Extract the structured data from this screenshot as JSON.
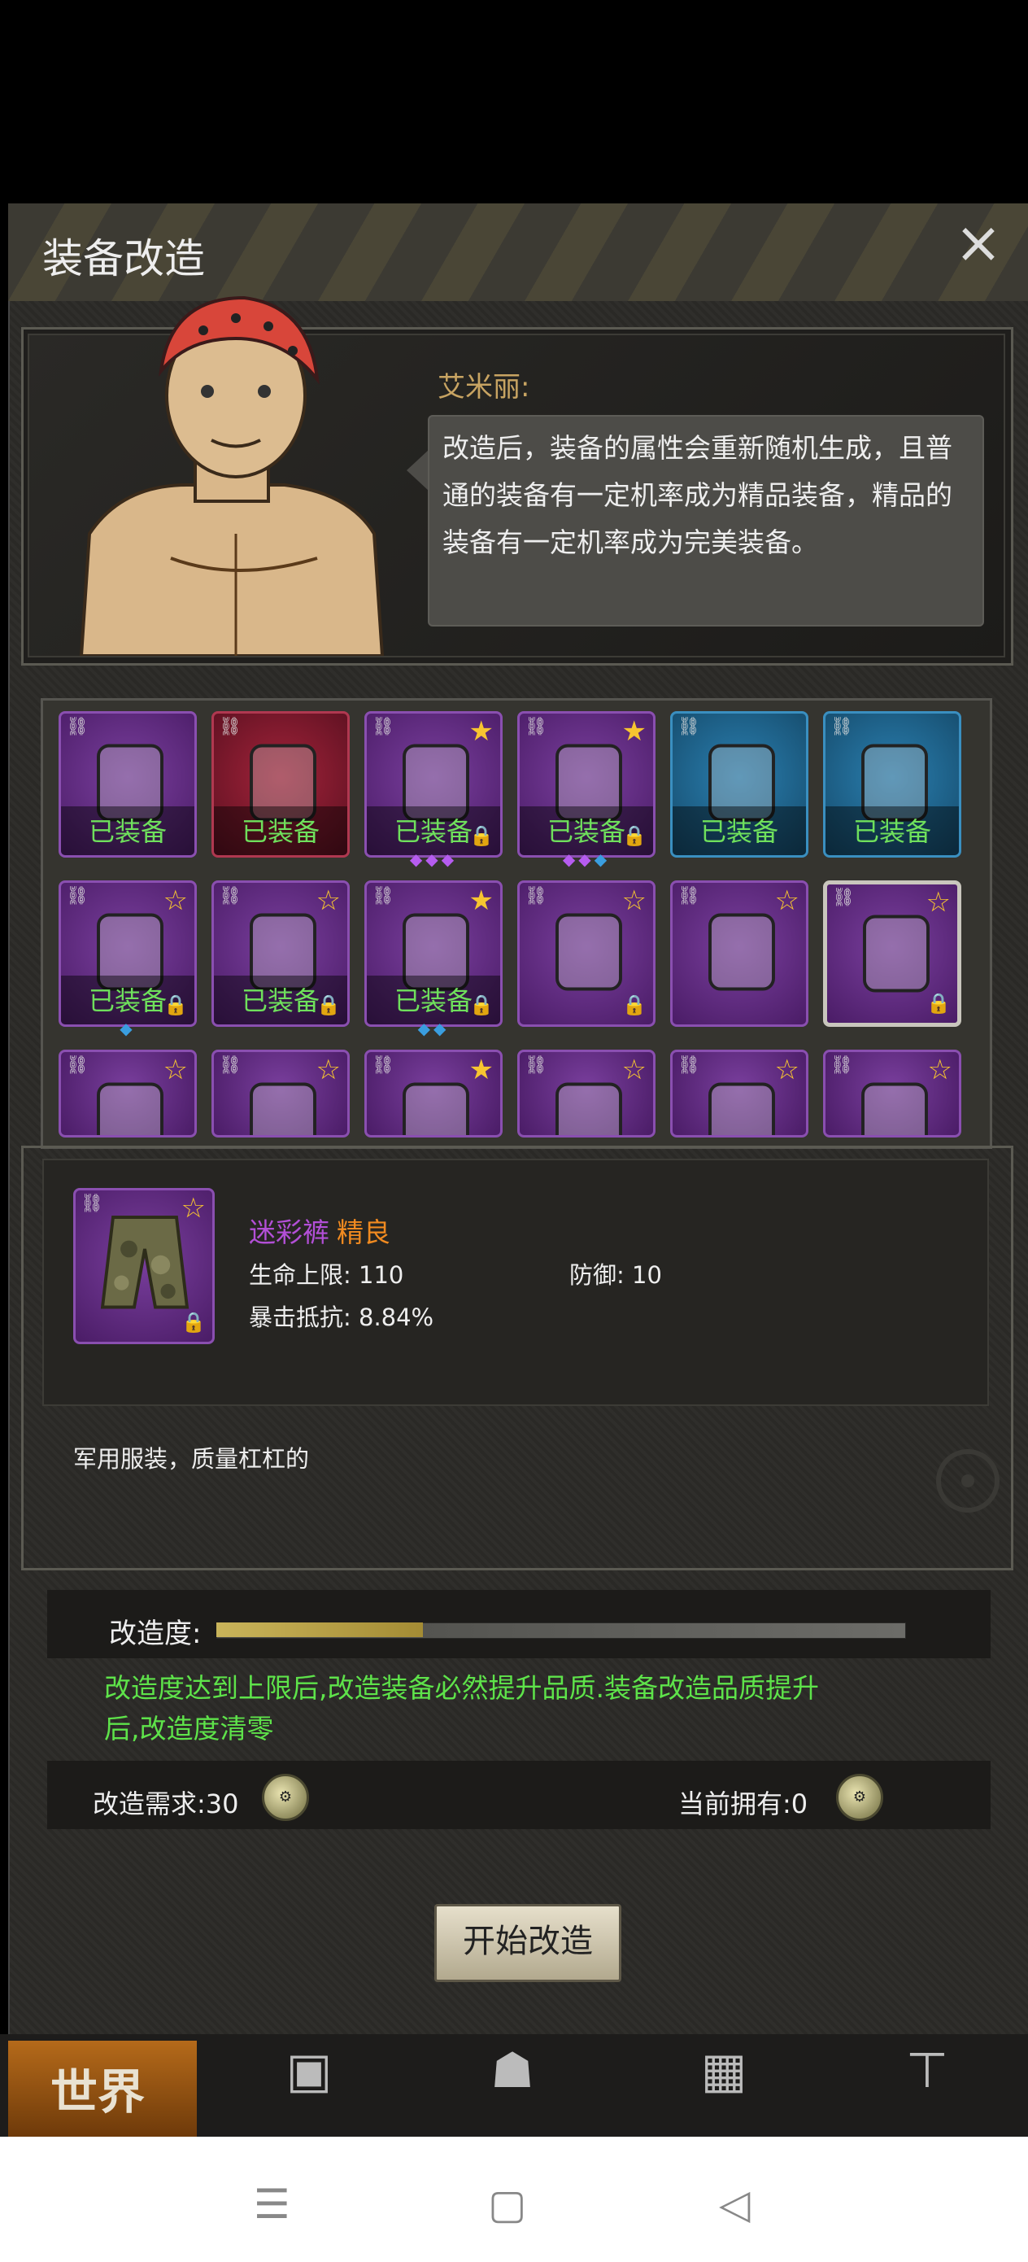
{
  "window": {
    "title": "装备改造",
    "close_icon": "close-icon"
  },
  "npc": {
    "name": "艾米丽:",
    "speech": "改造后，装备的属性会重新随机生成，且普通的装备有一定机率成为精品装备，精品的装备有一定机率成为完美装备。"
  },
  "inventory": {
    "equipped_label": "已装备",
    "items": [
      {
        "name": "parka-coat",
        "rarity": "purple",
        "equipped": true,
        "star": "none",
        "lock": false,
        "gems": []
      },
      {
        "name": "football-helmet",
        "rarity": "red",
        "equipped": true,
        "star": "none",
        "lock": false,
        "gems": []
      },
      {
        "name": "police-helmet",
        "rarity": "purple",
        "equipped": true,
        "star": "filled",
        "lock": true,
        "gems": [
          "purple",
          "purple",
          "purple"
        ]
      },
      {
        "name": "camo-rifle",
        "rarity": "purple",
        "equipped": true,
        "star": "filled",
        "lock": true,
        "gems": [
          "purple",
          "purple",
          "blue"
        ]
      },
      {
        "name": "riot-shield-1",
        "rarity": "blue",
        "equipped": true,
        "star": "none",
        "lock": false,
        "gems": []
      },
      {
        "name": "riot-shield-2",
        "rarity": "blue",
        "equipped": true,
        "star": "none",
        "lock": false,
        "gems": []
      },
      {
        "name": "katana",
        "rarity": "purple",
        "equipped": true,
        "star": "outline",
        "lock": true,
        "gems": [
          "blue"
        ]
      },
      {
        "name": "ice-sword",
        "rarity": "purple",
        "equipped": true,
        "star": "outline",
        "lock": true,
        "gems": []
      },
      {
        "name": "machete",
        "rarity": "purple",
        "equipped": true,
        "star": "filled",
        "lock": true,
        "gems": [
          "blue",
          "blue"
        ]
      },
      {
        "name": "tactical-vest",
        "rarity": "purple",
        "equipped": false,
        "star": "outline",
        "lock": true,
        "gems": []
      },
      {
        "name": "camo-boots",
        "rarity": "purple",
        "equipped": false,
        "star": "outline",
        "lock": false,
        "gems": []
      },
      {
        "name": "camo-pants",
        "rarity": "purple",
        "equipped": false,
        "star": "outline",
        "lock": true,
        "gems": [],
        "selected": true
      },
      {
        "name": "camo-vest",
        "rarity": "purple",
        "equipped": false,
        "star": "outline",
        "lock": false,
        "gems": []
      },
      {
        "name": "camo-jacket",
        "rarity": "purple",
        "equipped": false,
        "star": "outline",
        "lock": false,
        "gems": []
      },
      {
        "name": "camo-helmet",
        "rarity": "purple",
        "equipped": false,
        "star": "filled",
        "lock": false,
        "gems": []
      },
      {
        "name": "crossbow",
        "rarity": "purple",
        "equipped": false,
        "star": "outline",
        "lock": false,
        "gems": []
      },
      {
        "name": "sniper-rifle",
        "rarity": "purple",
        "equipped": false,
        "star": "outline",
        "lock": false,
        "gems": []
      },
      {
        "name": "pistol",
        "rarity": "purple",
        "equipped": false,
        "star": "outline",
        "lock": false,
        "gems": []
      }
    ]
  },
  "detail": {
    "name": "迷彩裤",
    "quality": "精良",
    "stat_hp": "生命上限: 110",
    "stat_def": "防御: 10",
    "stat_crit": "暴击抵抗: 8.84%",
    "description": "军用服装，质量杠杠的",
    "colors": {
      "name": "#b24fd6",
      "quality": "#f08a20"
    }
  },
  "modify": {
    "progress_label": "改造度:",
    "progress_fraction": 0.3,
    "note": "改造度达到上限后,改造装备必然提升品质.装备改造品质提升后,改造度清零",
    "requirement": "改造需求:30",
    "owned": "当前拥有:0",
    "start_button": "开始改造"
  },
  "nav": {
    "world": "世界"
  }
}
